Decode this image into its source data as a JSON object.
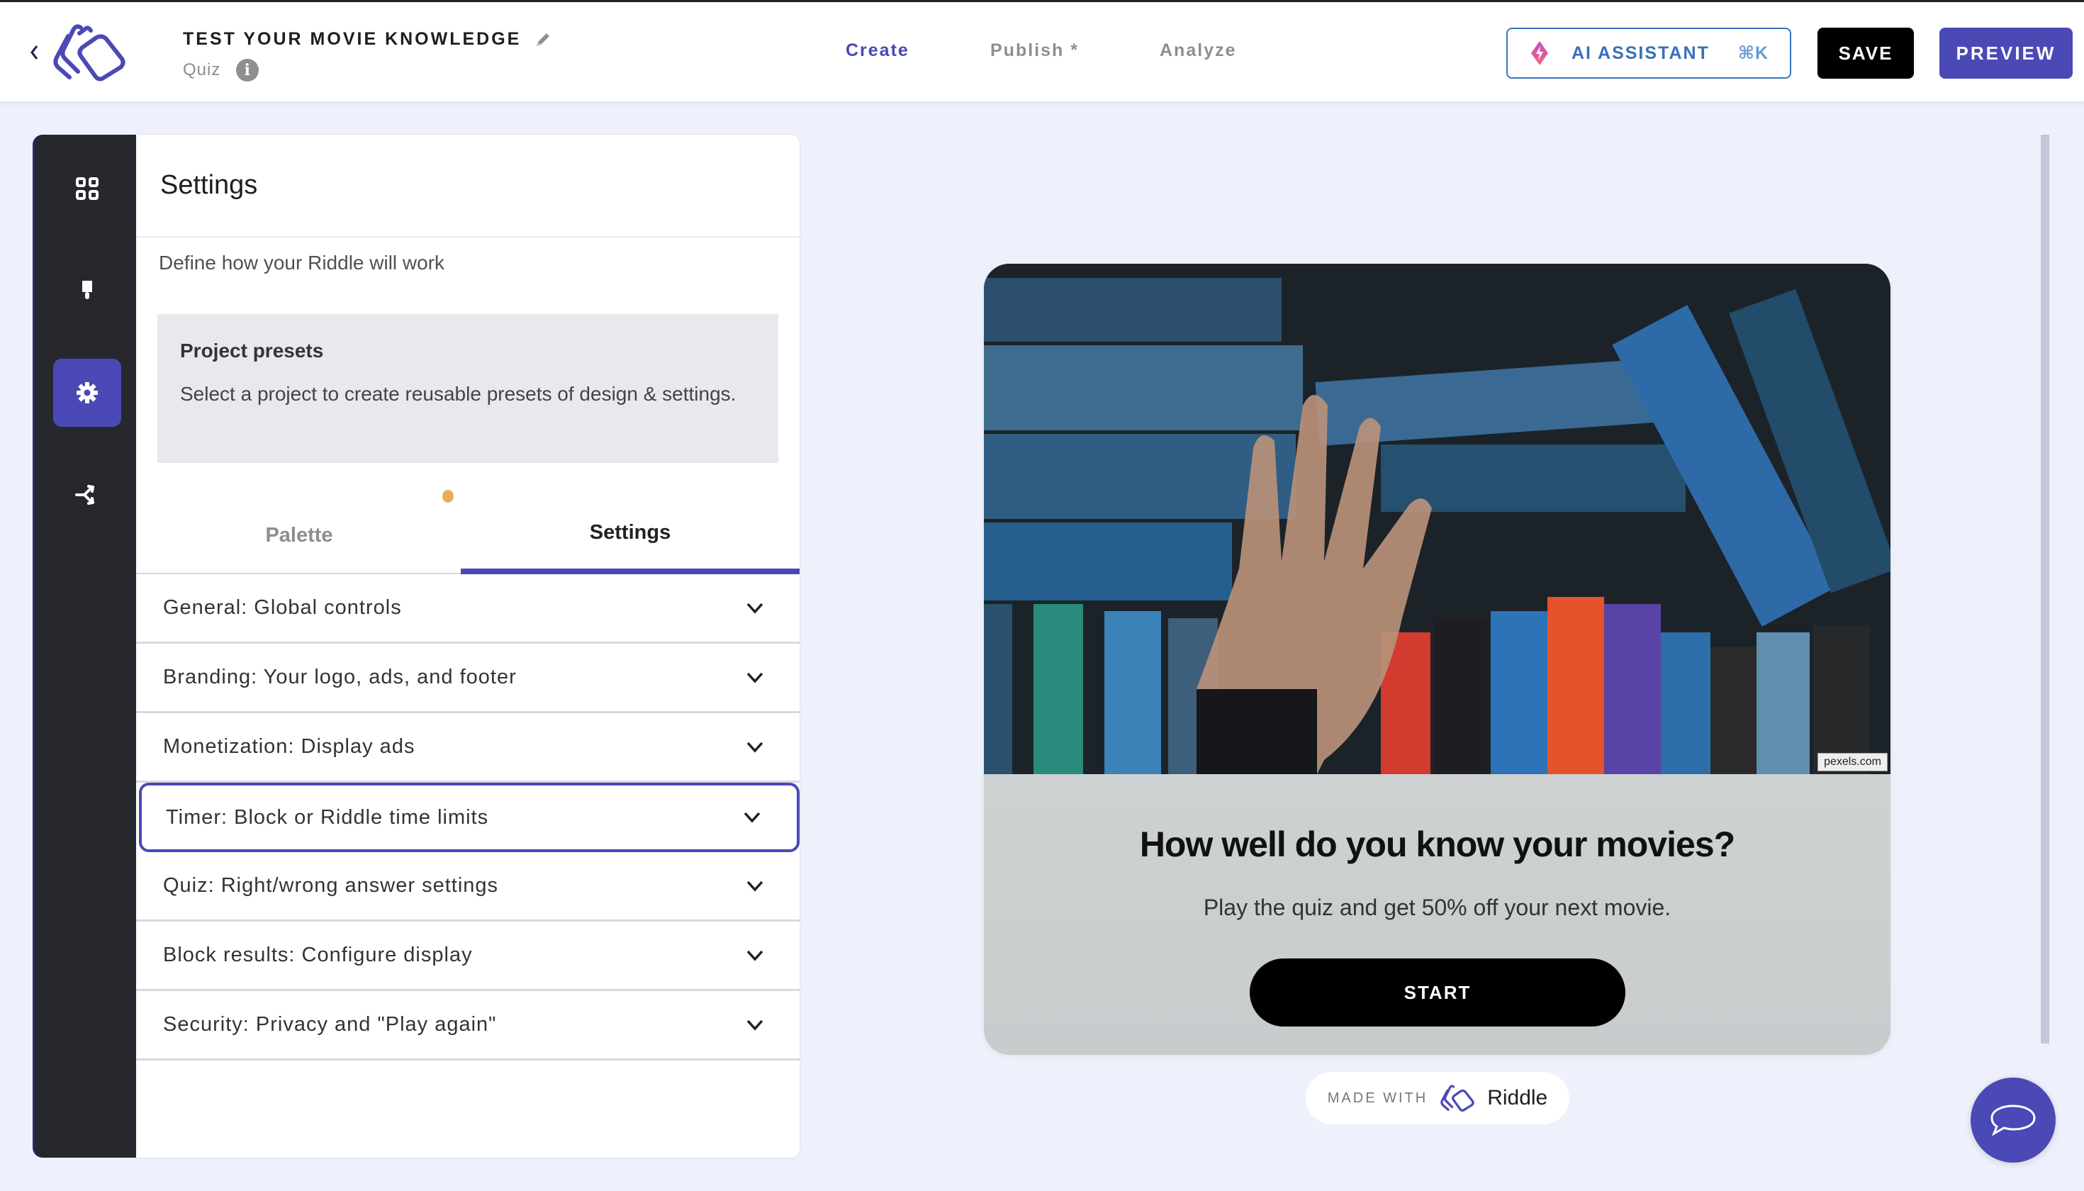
{
  "header": {
    "back_icon": "chevron-left-icon",
    "logo": "riddle-logo",
    "title": "TEST YOUR MOVIE KNOWLEDGE",
    "title_edit_icon": "pencil-icon",
    "subtitle": "Quiz",
    "info_icon": "info-icon",
    "info_glyph": "i",
    "nav": [
      {
        "label": "Create",
        "active": true
      },
      {
        "label": "Publish *",
        "active": false
      },
      {
        "label": "Analyze",
        "active": false
      }
    ],
    "ai_assistant": {
      "label": "AI ASSISTANT",
      "shortcut": "⌘K",
      "icon": "lightning-diamond-icon"
    },
    "save_label": "SAVE",
    "preview_label": "PREVIEW"
  },
  "sidebar": {
    "items": [
      {
        "name": "blocks",
        "icon": "grid-icon",
        "active": false
      },
      {
        "name": "design",
        "icon": "paintbrush-icon",
        "active": false
      },
      {
        "name": "settings",
        "icon": "gear-icon",
        "active": true
      },
      {
        "name": "logic",
        "icon": "branch-icon",
        "active": false
      }
    ]
  },
  "panel": {
    "title": "Settings",
    "description": "Define how your Riddle will work",
    "presets": {
      "title": "Project presets",
      "text": "Select a project to create reusable presets of design & settings."
    },
    "tabs": [
      {
        "label": "Palette",
        "active": false,
        "has_indicator": true
      },
      {
        "label": "Settings",
        "active": true
      }
    ],
    "accordions": [
      {
        "label": "General: Global controls",
        "focused": false
      },
      {
        "label": "Branding: Your logo, ads, and footer",
        "focused": false
      },
      {
        "label": "Monetization: Display ads",
        "focused": false
      },
      {
        "label": "Timer: Block or Riddle time limits",
        "focused": true
      },
      {
        "label": "Quiz: Right/wrong answer settings",
        "focused": false
      },
      {
        "label": "Block results: Configure display",
        "focused": false
      },
      {
        "label": "Security: Privacy and \"Play again\"",
        "focused": false
      }
    ]
  },
  "preview": {
    "image_credit": "pexels.com",
    "title": "How well do you know your movies?",
    "subtitle": "Play the quiz and get 50% off your next movie.",
    "start_label": "START",
    "made_with": "MADE WITH",
    "brand": "Riddle"
  },
  "colors": {
    "accent": "#4b49b5",
    "ai_blue": "#3a6fb8",
    "indicator": "#e6b058",
    "sidebar_bg": "#27282e",
    "page_bg": "#eef1fb"
  }
}
